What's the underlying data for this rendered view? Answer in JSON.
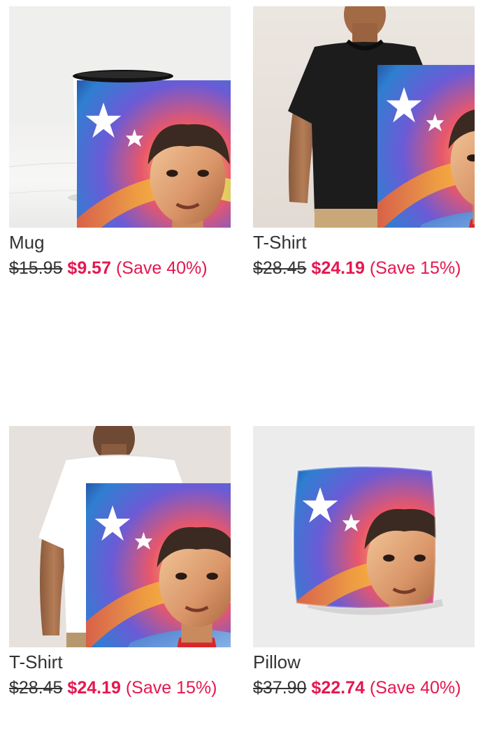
{
  "products": [
    {
      "name": "Mug",
      "old_price": "$15.95",
      "new_price": "$9.57",
      "save": "(Save 40%)",
      "image_icon": "mug-product-image"
    },
    {
      "name": "T-Shirt",
      "old_price": "$28.45",
      "new_price": "$24.19",
      "save": "(Save 15%)",
      "image_icon": "black-tshirt-product-image"
    },
    {
      "name": "T-Shirt",
      "old_price": "$28.45",
      "new_price": "$24.19",
      "save": "(Save 15%)",
      "image_icon": "white-tshirt-back-product-image"
    },
    {
      "name": "Pillow",
      "old_price": "$37.90",
      "new_price": "$22.74",
      "save": "(Save 40%)",
      "image_icon": "pillow-product-image"
    }
  ],
  "colors": {
    "sale": "#e5174f",
    "text": "#333333"
  }
}
